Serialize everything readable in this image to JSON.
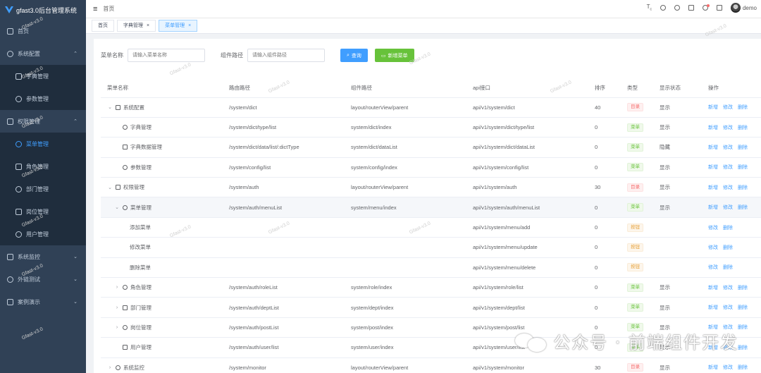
{
  "app": {
    "title": "gfast3.0后台管理系统",
    "accent": "#409eff",
    "sidebar_bg": "#304156"
  },
  "sidebar": {
    "items": [
      {
        "label": "首页",
        "icon": "home-icon"
      },
      {
        "label": "系统配置",
        "icon": "settings-icon",
        "expanded": true
      },
      {
        "label": "字典管理",
        "icon": "dict-icon",
        "sub": true
      },
      {
        "label": "参数管理",
        "icon": "param-icon",
        "sub": true
      },
      {
        "label": "权限管理",
        "icon": "user-icon",
        "expanded": true
      },
      {
        "label": "菜单管理",
        "icon": "menu-icon",
        "sub": true,
        "active": true
      },
      {
        "label": "角色管理",
        "icon": "role-icon",
        "sub": true
      },
      {
        "label": "部门管理",
        "icon": "dept-icon",
        "sub": true
      },
      {
        "label": "岗位管理",
        "icon": "post-icon",
        "sub": true
      },
      {
        "label": "用户管理",
        "icon": "user-icon",
        "sub": true
      },
      {
        "label": "系统监控",
        "icon": "monitor-icon"
      },
      {
        "label": "外链测试",
        "icon": "link-icon"
      },
      {
        "label": "案例演示",
        "icon": "demo-icon"
      }
    ]
  },
  "topbar": {
    "breadcrumb": "首页",
    "user": "demo"
  },
  "tags": [
    {
      "label": "首页"
    },
    {
      "label": "字典管理"
    },
    {
      "label": "菜单管理",
      "active": true
    }
  ],
  "search": {
    "menu_name_label": "菜单名称",
    "menu_name_placeholder": "请输入菜单名称",
    "component_label": "组件路径",
    "component_placeholder": "请输入组件路径",
    "query_btn": "查询",
    "add_btn": "新增菜单"
  },
  "table": {
    "headers": [
      "菜单名称",
      "路由路径",
      "组件路径",
      "api接口",
      "排序",
      "类型",
      "显示状态",
      "操作"
    ],
    "rows": [
      {
        "level": 0,
        "arrow": "⌄",
        "icon": "settings-icon",
        "name": "系统配置",
        "route": "/system/dict",
        "component": "layout/routerView/parent",
        "api": "api/v1/system/dict",
        "sort": "40",
        "type": "目录",
        "typeColor": "red",
        "status": "显示",
        "ops": [
          "新增",
          "修改",
          "删除"
        ]
      },
      {
        "level": 1,
        "arrow": "",
        "icon": "dict-icon",
        "name": "字典管理",
        "route": "/system/dict/type/list",
        "component": "system/dict/index",
        "api": "api/v1/system/dict/type/list",
        "sort": "0",
        "type": "菜单",
        "typeColor": "green",
        "status": "显示",
        "ops": [
          "新增",
          "修改",
          "删除"
        ]
      },
      {
        "level": 1,
        "arrow": "",
        "icon": "doc-icon",
        "name": "字典数据管理",
        "route": "/system/dict/data/list/:dictType",
        "component": "system/dict/dataList",
        "api": "api/v1/system/dict/dataList",
        "sort": "0",
        "type": "菜单",
        "typeColor": "green",
        "status": "隐藏",
        "ops": [
          "新增",
          "修改",
          "删除"
        ]
      },
      {
        "level": 1,
        "arrow": "",
        "icon": "param-icon",
        "name": "参数管理",
        "route": "/system/config/list",
        "component": "system/config/index",
        "api": "api/v1/system/config/list",
        "sort": "0",
        "type": "菜单",
        "typeColor": "green",
        "status": "显示",
        "ops": [
          "新增",
          "修改",
          "删除"
        ]
      },
      {
        "level": 0,
        "arrow": "⌄",
        "icon": "user-icon",
        "name": "权限管理",
        "route": "/system/auth",
        "component": "layout/routerView/parent",
        "api": "api/v1/system/auth",
        "sort": "30",
        "type": "目录",
        "typeColor": "red",
        "status": "显示",
        "ops": [
          "新增",
          "修改",
          "删除"
        ]
      },
      {
        "level": 1,
        "arrow": "⌄",
        "icon": "menu-icon",
        "name": "菜单管理",
        "route": "/system/auth/menuList",
        "component": "system/menu/index",
        "api": "api/v1/system/auth/menuList",
        "sort": "0",
        "type": "菜单",
        "typeColor": "green",
        "status": "显示",
        "ops": [
          "新增",
          "修改",
          "删除"
        ],
        "hl": true
      },
      {
        "level": 2,
        "arrow": "",
        "icon": "",
        "name": "添加菜单",
        "route": "",
        "component": "",
        "api": "api/v1/system/menu/add",
        "sort": "0",
        "type": "按钮",
        "typeColor": "orange",
        "status": "",
        "ops": [
          "修改",
          "删除"
        ]
      },
      {
        "level": 2,
        "arrow": "",
        "icon": "",
        "name": "修改菜单",
        "route": "",
        "component": "",
        "api": "api/v1/system/menu/update",
        "sort": "0",
        "type": "按钮",
        "typeColor": "orange",
        "status": "",
        "ops": [
          "修改",
          "删除"
        ]
      },
      {
        "level": 2,
        "arrow": "",
        "icon": "",
        "name": "删除菜单",
        "route": "",
        "component": "",
        "api": "api/v1/system/menu/delete",
        "sort": "0",
        "type": "按钮",
        "typeColor": "orange",
        "status": "",
        "ops": [
          "修改",
          "删除"
        ]
      },
      {
        "level": 1,
        "arrow": "›",
        "icon": "role-icon",
        "name": "角色管理",
        "route": "/system/auth/roleList",
        "component": "system/role/index",
        "api": "api/v1/system/role/list",
        "sort": "0",
        "type": "菜单",
        "typeColor": "green",
        "status": "显示",
        "ops": [
          "新增",
          "修改",
          "删除"
        ]
      },
      {
        "level": 1,
        "arrow": "›",
        "icon": "dept-icon",
        "name": "部门管理",
        "route": "/system/auth/deptList",
        "component": "system/dept/index",
        "api": "api/v1/system/dept/list",
        "sort": "0",
        "type": "菜单",
        "typeColor": "green",
        "status": "显示",
        "ops": [
          "新增",
          "修改",
          "删除"
        ]
      },
      {
        "level": 1,
        "arrow": "›",
        "icon": "post-icon",
        "name": "岗位管理",
        "route": "/system/auth/postList",
        "component": "system/post/index",
        "api": "api/v1/system/post/list",
        "sort": "0",
        "type": "菜单",
        "typeColor": "green",
        "status": "显示",
        "ops": [
          "新增",
          "修改",
          "删除"
        ]
      },
      {
        "level": 1,
        "arrow": "",
        "icon": "user-icon",
        "name": "用户管理",
        "route": "/system/auth/user/list",
        "component": "system/user/index",
        "api": "api/v1/system/user/list",
        "sort": "0",
        "type": "菜单",
        "typeColor": "green",
        "status": "显示",
        "ops": [
          "新增",
          "修改",
          "删除"
        ]
      },
      {
        "level": 0,
        "arrow": "›",
        "icon": "monitor-icon",
        "name": "系统监控",
        "route": "/system/monitor",
        "component": "layout/routerView/parent",
        "api": "api/v1/system/monitor",
        "sort": "30",
        "type": "目录",
        "typeColor": "red",
        "status": "显示",
        "ops": [
          "新增",
          "修改",
          "删除"
        ]
      }
    ]
  },
  "watermark": {
    "text": "Gfast-v3.0",
    "overlay": "公众号 · 前端组件开发"
  }
}
